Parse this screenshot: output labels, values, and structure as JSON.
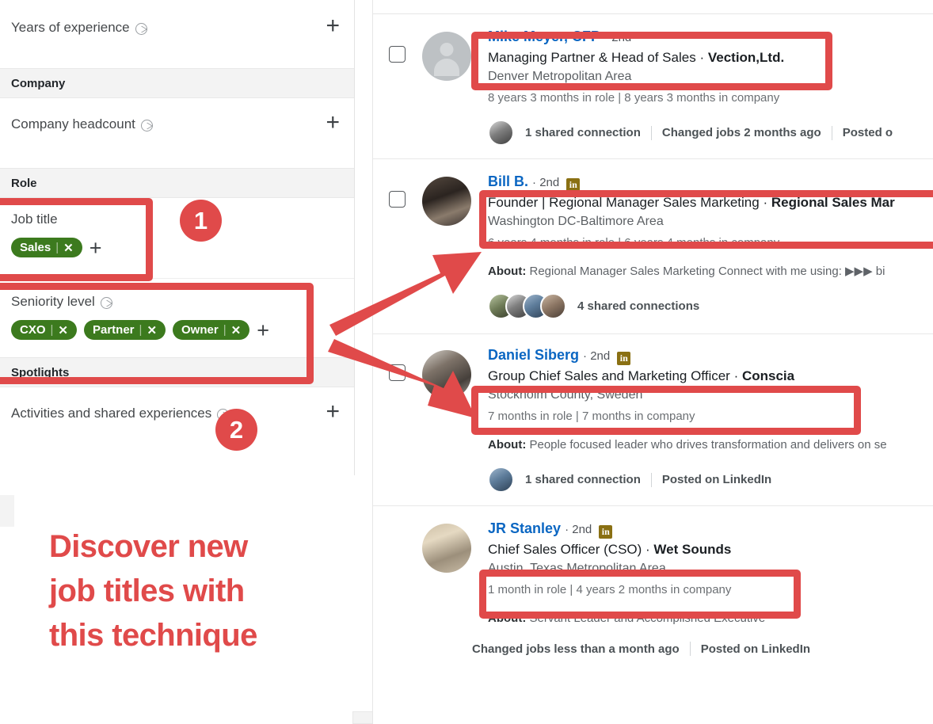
{
  "sidebar": {
    "rows": [
      {
        "label": "Years of experience",
        "has_compass": true,
        "add_label": "+"
      }
    ],
    "sections": [
      {
        "title": "Company"
      },
      {
        "title": "Role"
      },
      {
        "title": "Spotlights"
      }
    ],
    "company_headcount": {
      "label": "Company headcount",
      "add_label": "+"
    },
    "job_title": {
      "label": "Job title",
      "tags": [
        {
          "text": "Sales",
          "remove": "✕"
        }
      ],
      "add_label": "+"
    },
    "seniority_level": {
      "label": "Seniority level",
      "tags": [
        {
          "text": "CXO",
          "remove": "✕"
        },
        {
          "text": "Partner",
          "remove": "✕"
        },
        {
          "text": "Owner",
          "remove": "✕"
        }
      ],
      "add_label": "+"
    },
    "activities": {
      "label": "Activities and shared experiences",
      "add_label": "+"
    }
  },
  "annotations": {
    "badge_one": "1",
    "badge_two": "2",
    "callout_line1": "Discover new",
    "callout_line2": "job titles with",
    "callout_line3": "this technique",
    "accent_red": "#E04A4A",
    "tag_green": "#3C7A1E",
    "link_blue": "#0A66C2"
  },
  "results": [
    {
      "name": "Mike Meyer, CFP",
      "degree": "· 2nd",
      "badge": "",
      "headline_role": "Managing Partner & Head of Sales",
      "headline_company": "Vection,Ltd.",
      "location": "Denver Metropolitan Area",
      "tenure": "8 years 3 months in role | 8 years 3 months in company",
      "about_label": "",
      "about_text": "",
      "shared": "1 shared connection",
      "meta2": "Changed jobs 2 months ago",
      "meta3": "Posted o"
    },
    {
      "name": "Bill B.",
      "degree": "· 2nd",
      "badge": "in",
      "headline_role": "Founder | Regional Manager Sales Marketing",
      "headline_company": "Regional Sales Mar",
      "location": "Washington DC-Baltimore Area",
      "tenure": "6 years 4 months in role | 6 years 4 months in company",
      "about_label": "About:",
      "about_text": "Regional Manager Sales Marketing Connect with me using: ▶▶▶ bi",
      "shared": "4 shared connections",
      "meta2": "",
      "meta3": ""
    },
    {
      "name": "Daniel Siberg",
      "degree": "· 2nd",
      "badge": "in",
      "headline_role": "Group Chief Sales and Marketing Officer",
      "headline_company": "Conscia",
      "location": "Stockholm County, Sweden",
      "tenure": "7 months in role | 7 months in company",
      "about_label": "About:",
      "about_text": "People focused leader who drives transformation and delivers on se",
      "shared": "1 shared connection",
      "meta2": "Posted on LinkedIn",
      "meta3": ""
    },
    {
      "name": "JR Stanley",
      "degree": "· 2nd",
      "badge": "in",
      "headline_role": "Chief Sales Officer (CSO)",
      "headline_company": "Wet Sounds",
      "location": "Austin, Texas Metropolitan Area",
      "tenure": "1 month in role | 4 years 2 months in company",
      "about_label": "About:",
      "about_text": "Servant Leader and Accomplished Executive",
      "shared": "",
      "meta2": "Changed jobs less than a month ago",
      "meta3": "Posted on LinkedIn"
    }
  ]
}
